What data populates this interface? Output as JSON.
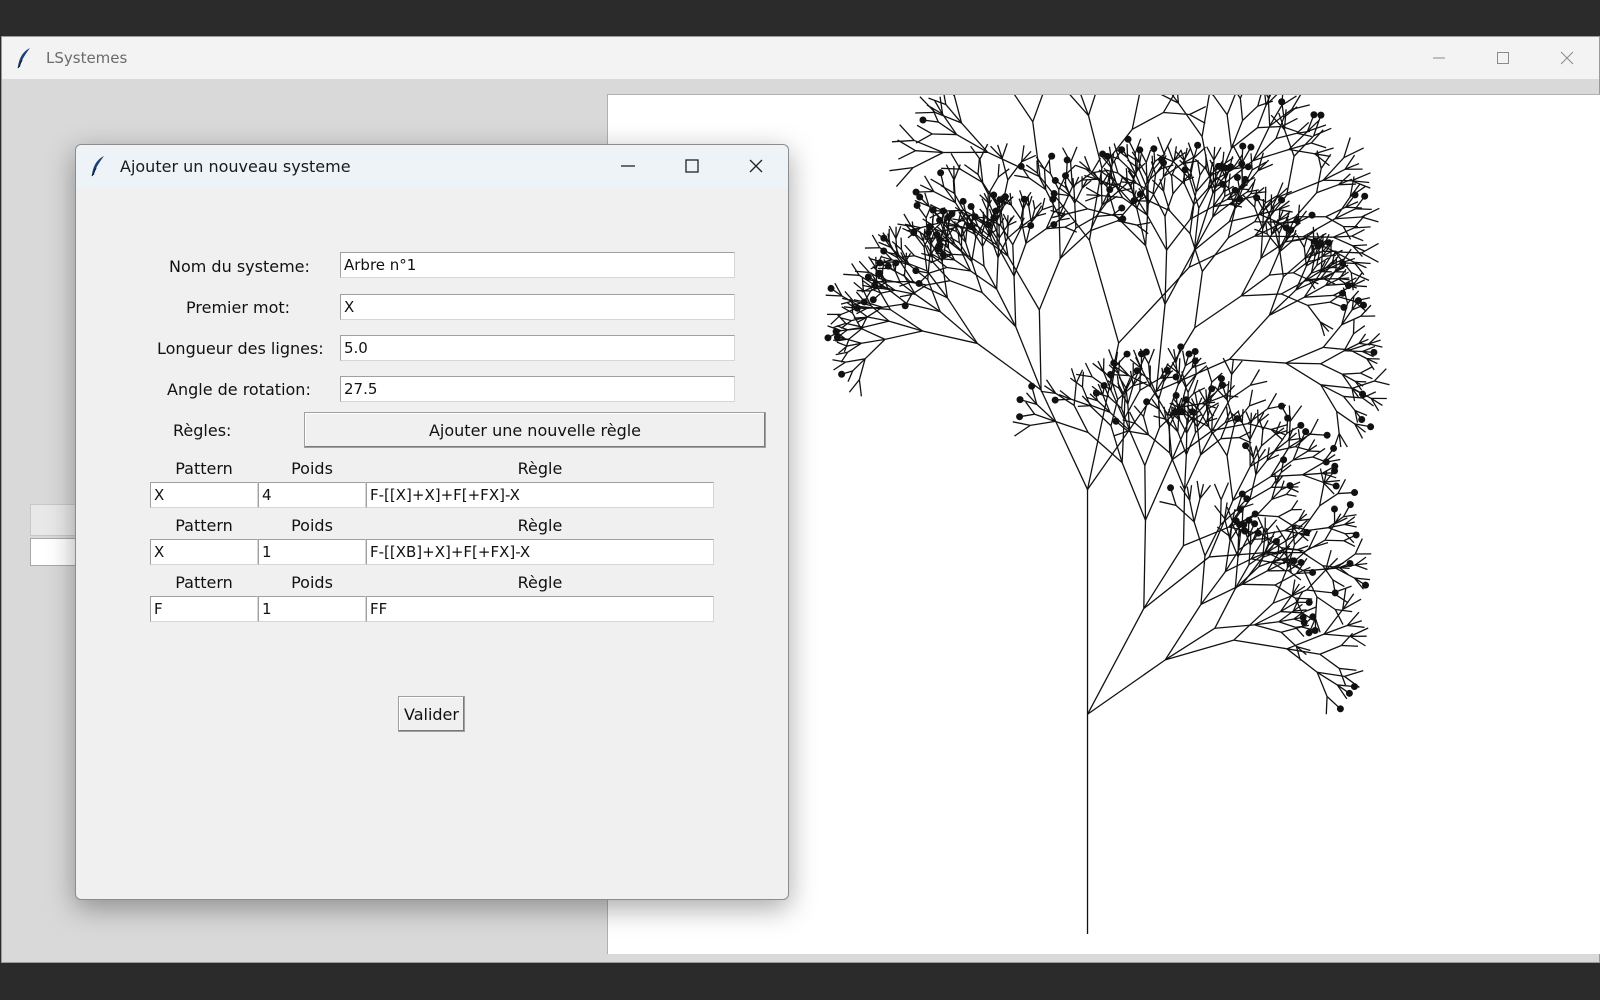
{
  "main_window": {
    "title": "LSystemes"
  },
  "dialog": {
    "title": "Ajouter un nouveau systeme",
    "fields": {
      "name_label": "Nom du systeme:",
      "name_value": "Arbre n°1",
      "first_word_label": "Premier mot:",
      "first_word_value": "X",
      "line_length_label": "Longueur des lignes:",
      "line_length_value": "5.0",
      "angle_label": "Angle de rotation:",
      "angle_value": "27.5"
    },
    "rules_label": "Règles:",
    "add_rule_button": "Ajouter une nouvelle règle",
    "rule_headers": {
      "pattern": "Pattern",
      "weight": "Poids",
      "rule": "Règle"
    },
    "rules": [
      {
        "pattern": "X",
        "weight": "4",
        "rule": "F-[[X]+X]+F[+FX]-X"
      },
      {
        "pattern": "X",
        "weight": "1",
        "rule": "F-[[XB]+X]+F[+FX]-X"
      },
      {
        "pattern": "F",
        "weight": "1",
        "rule": "FF"
      }
    ],
    "validate_button": "Valider"
  },
  "icons": {
    "app": "feather-icon",
    "minimize": "minimize-icon",
    "maximize": "maximize-icon",
    "close": "close-icon"
  }
}
